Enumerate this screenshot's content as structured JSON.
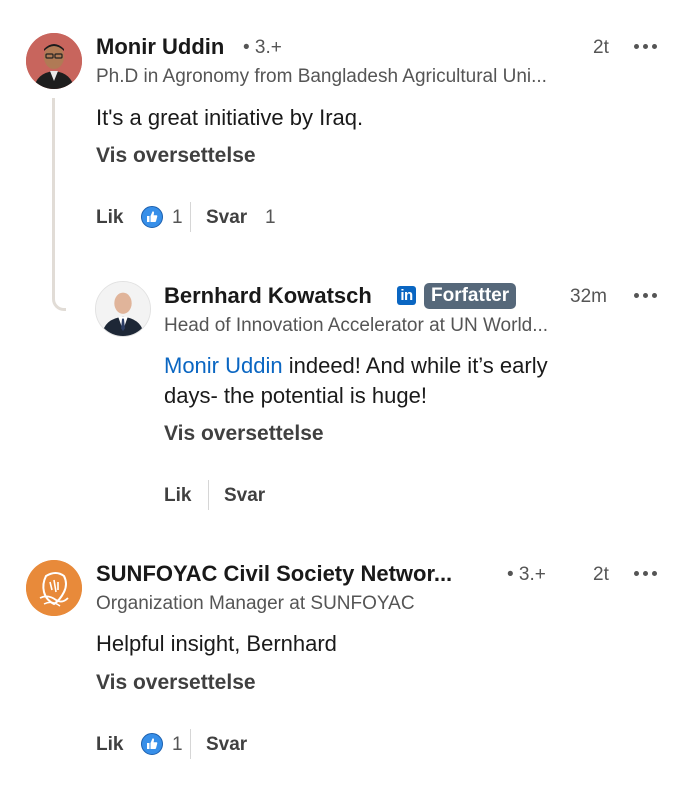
{
  "comments": [
    {
      "author": "Monir Uddin",
      "degree": "• 3.+",
      "time": "2t",
      "headline": "Ph.D in Agronomy from Bangladesh Agricultural Uni...",
      "text": "It's a great initiative by Iraq.",
      "translate_label": "Vis oversettelse",
      "like_label": "Lik",
      "like_count": "1",
      "reply_label": "Svar",
      "reply_count": "1"
    },
    {
      "author": "Bernhard Kowatsch",
      "linkedin_badge": "in",
      "author_badge": "Forfatter",
      "time": "32m",
      "headline": "Head of Innovation Accelerator at UN World...",
      "mention": "Monir Uddin",
      "text_line1": " indeed! And while it’s early",
      "text_line2": "days- the potential is huge!",
      "translate_label": "Vis oversettelse",
      "like_label": "Lik",
      "reply_label": "Svar"
    },
    {
      "author": "SUNFOYAC Civil Society Networ...",
      "degree": "• 3.+",
      "time": "2t",
      "headline": "Organization Manager at SUNFOYAC",
      "text": "Helpful insight, Bernhard",
      "translate_label": "Vis oversettelse",
      "like_label": "Lik",
      "like_count": "1",
      "reply_label": "Svar"
    }
  ],
  "icons": {
    "more": "more-horizontal-icon",
    "like": "thumbs-up-icon",
    "linkedin": "linkedin-icon"
  },
  "colors": {
    "link": "#0a66c2",
    "author_badge": "#56687a",
    "secondary_text": "#555555",
    "sunfoyac_orange": "#e88a3a"
  }
}
